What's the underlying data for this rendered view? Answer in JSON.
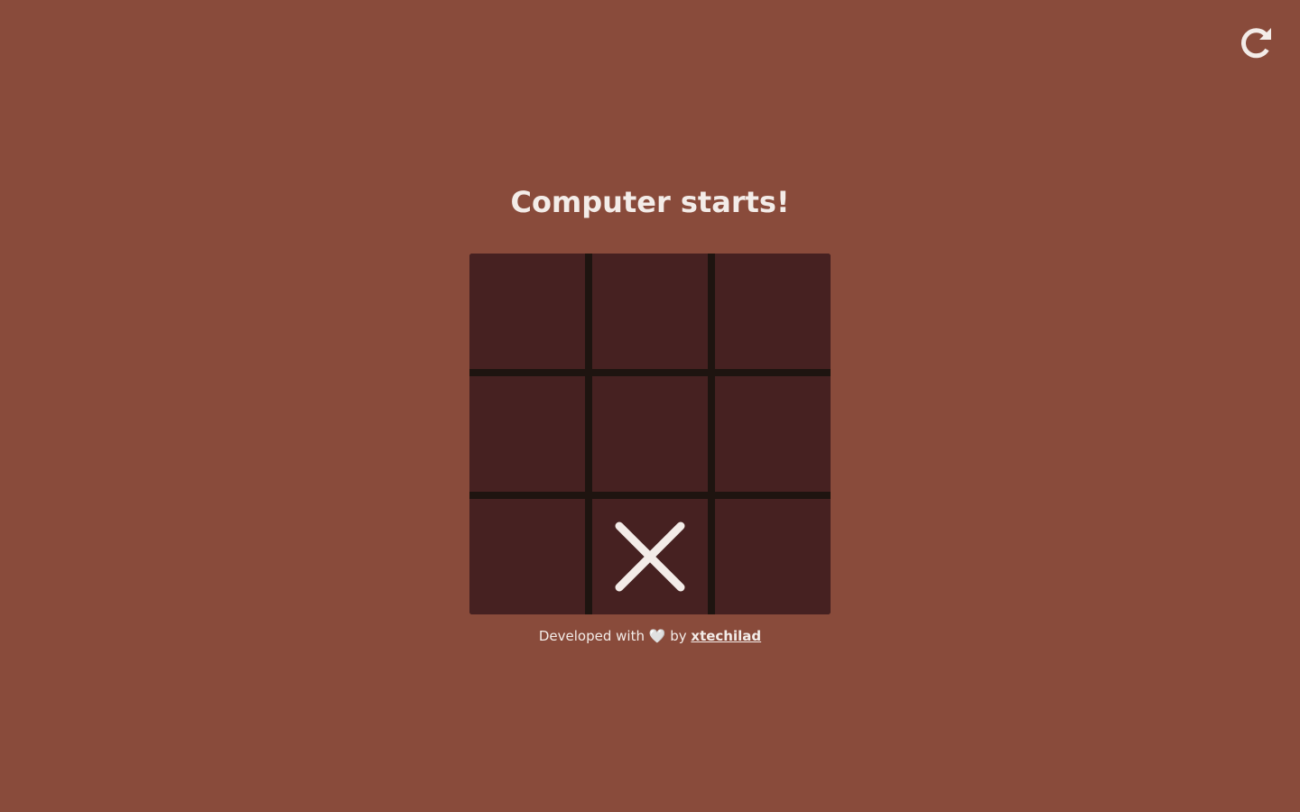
{
  "header": {
    "restart_icon": "restart-icon"
  },
  "status": {
    "title": "Computer starts!"
  },
  "board": {
    "cells": [
      "",
      "",
      "",
      "",
      "",
      "",
      "",
      "X",
      ""
    ]
  },
  "footer": {
    "prefix": "Developed with",
    "heart": "🤍",
    "by": "by",
    "author": "xtechilad"
  },
  "colors": {
    "background": "#894B3B",
    "cell": "#462121",
    "grid_lines": "#1E1410",
    "mark": "#F3ECE8"
  }
}
